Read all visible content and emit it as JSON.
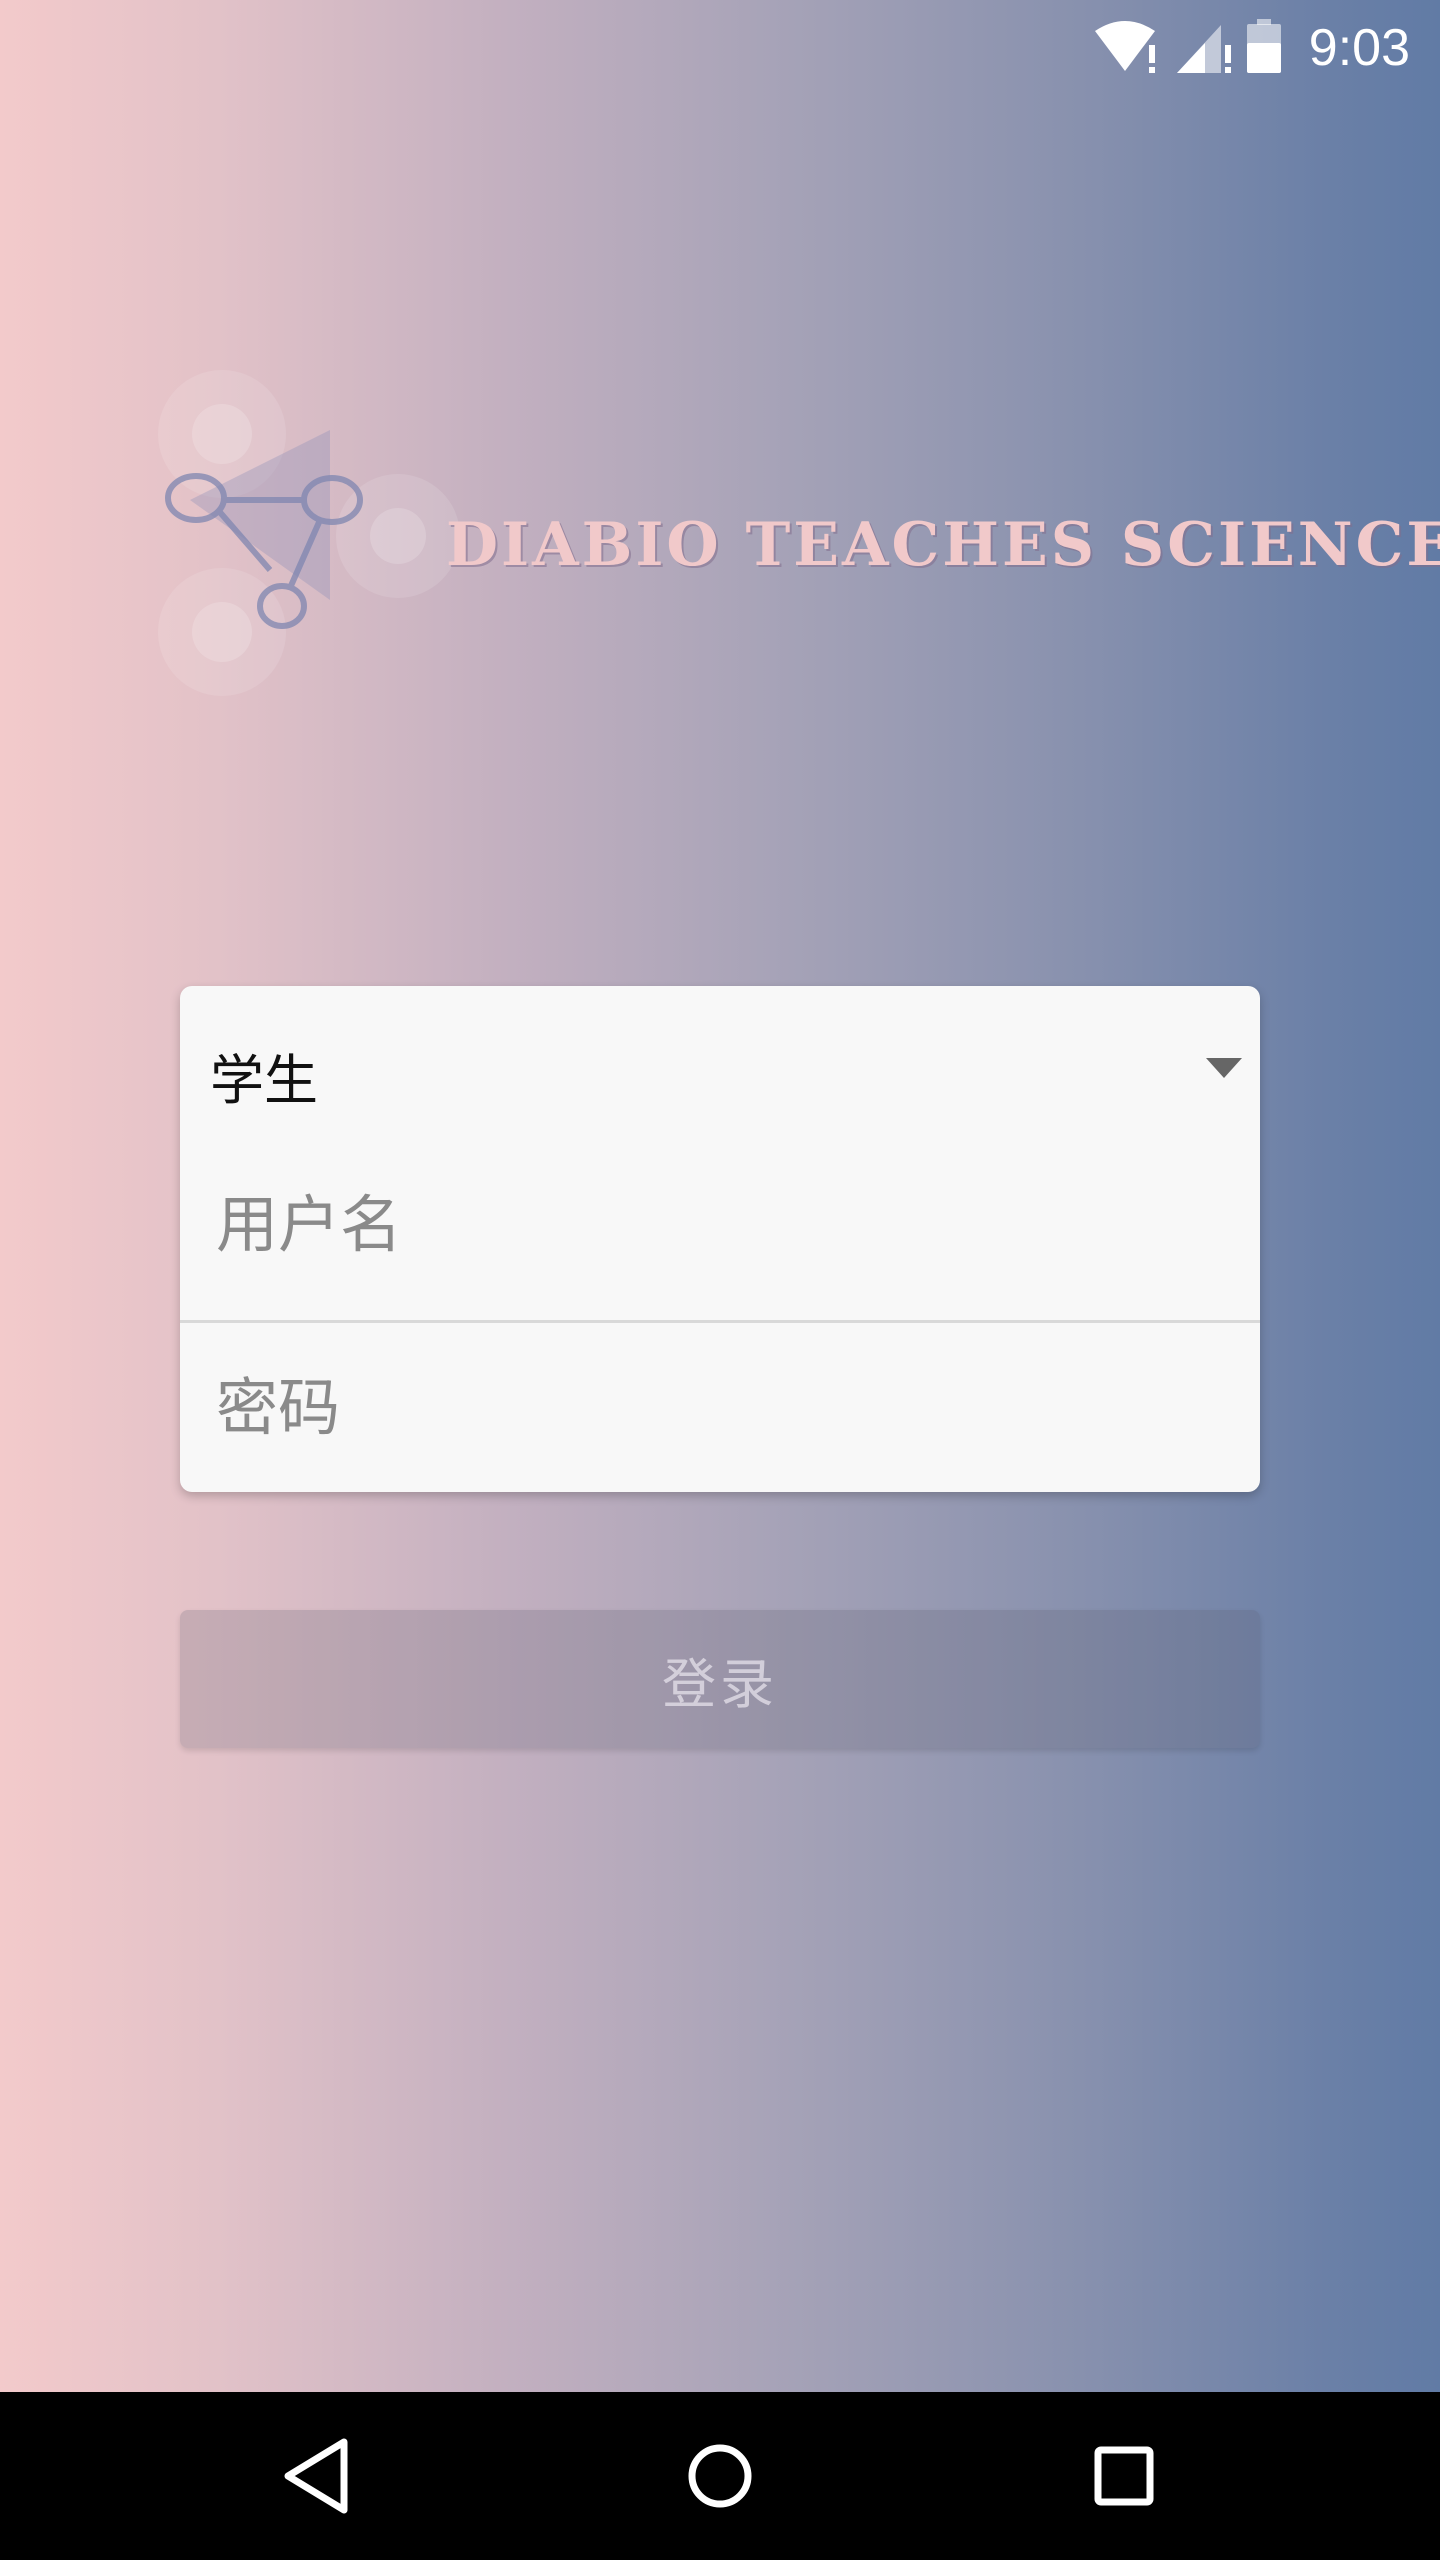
{
  "status_bar": {
    "time": "9:03",
    "icons": [
      "wifi-alert-icon",
      "cell-signal-alert-icon",
      "battery-icon"
    ]
  },
  "logo": {
    "text": "DIABIO TEACHES SCIENCE",
    "icon": "molecule-logo-icon"
  },
  "login_form": {
    "role_select": {
      "value": "学生"
    },
    "username": {
      "placeholder": "用户名",
      "value": ""
    },
    "password": {
      "placeholder": "密码",
      "value": ""
    }
  },
  "login_button": {
    "label": "登录"
  },
  "nav_bar": {
    "icons": [
      "back-icon",
      "home-icon",
      "recents-icon"
    ]
  },
  "colors": {
    "gradient_left": "#f3cacb",
    "gradient_right": "#617ba5",
    "card_background": "#f8f8f8",
    "logo_text": "#f1c9ca"
  }
}
